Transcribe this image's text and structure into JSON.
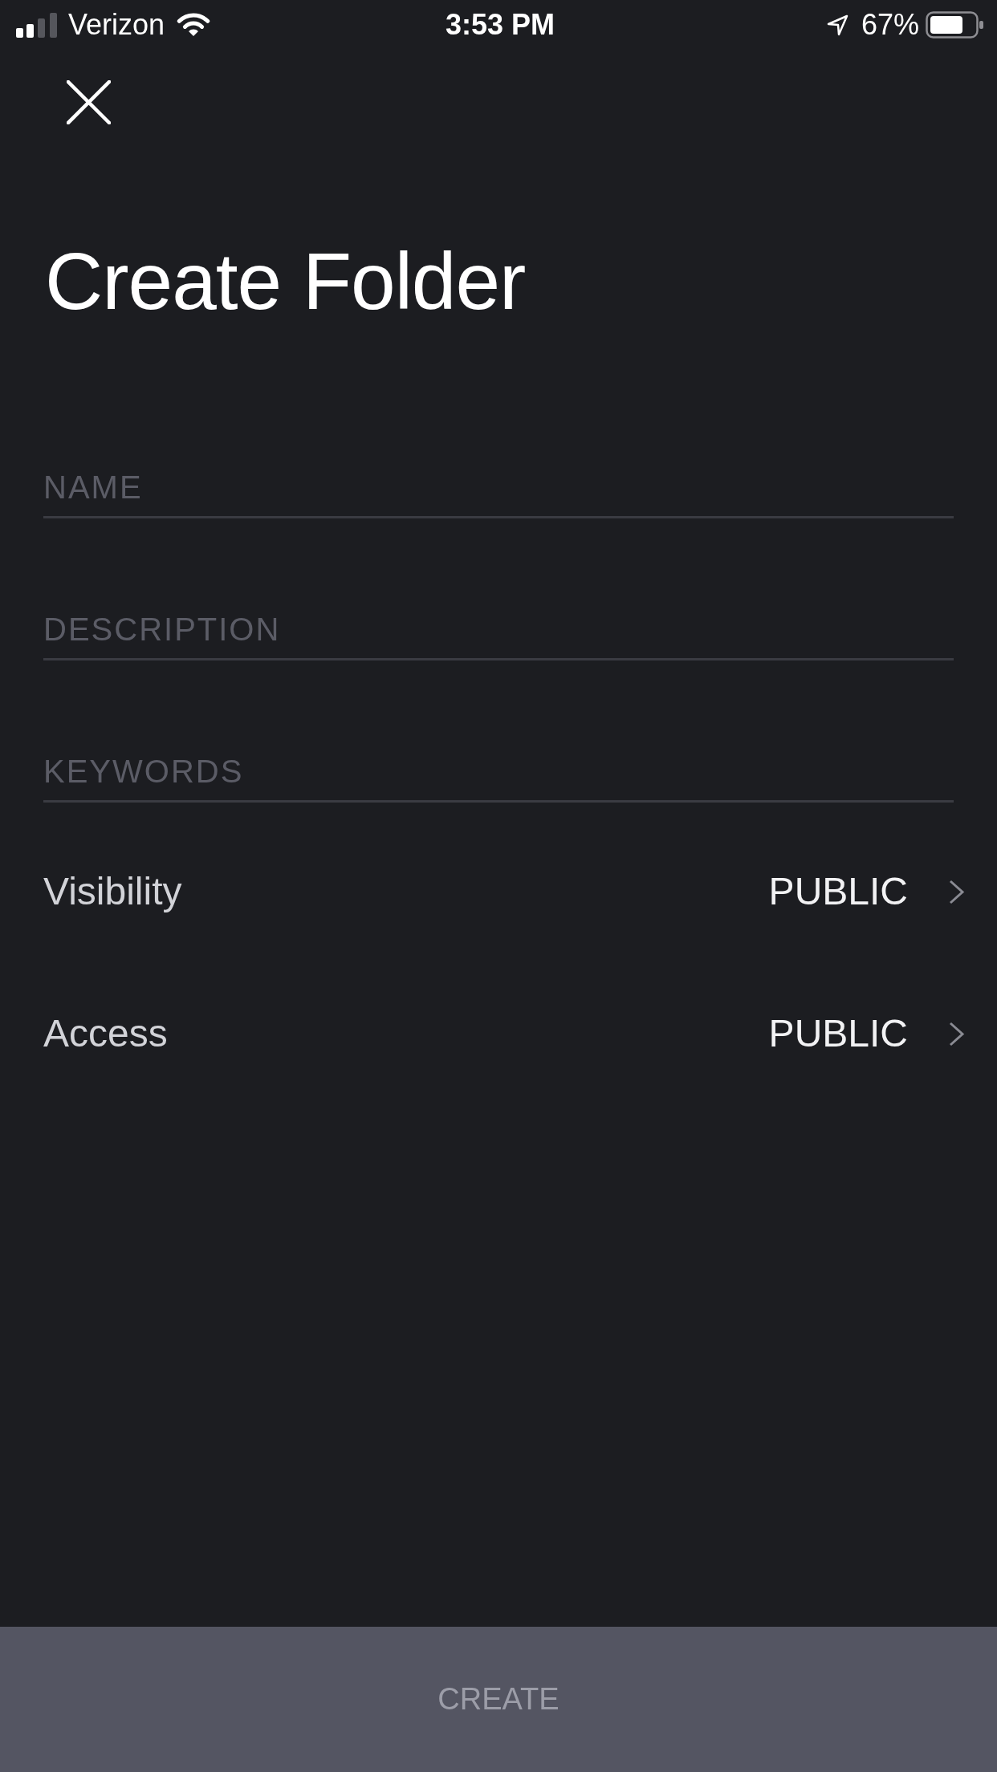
{
  "status_bar": {
    "carrier": "Verizon",
    "time": "3:53 PM",
    "battery": "67%"
  },
  "title": "Create Folder",
  "fields": [
    {
      "placeholder": "NAME"
    },
    {
      "placeholder": "DESCRIPTION"
    },
    {
      "placeholder": "KEYWORDS"
    }
  ],
  "options": [
    {
      "label": "Visibility",
      "value": "PUBLIC"
    },
    {
      "label": "Access",
      "value": "PUBLIC"
    }
  ],
  "create_button": {
    "label": "CREATE",
    "disabled": true
  }
}
